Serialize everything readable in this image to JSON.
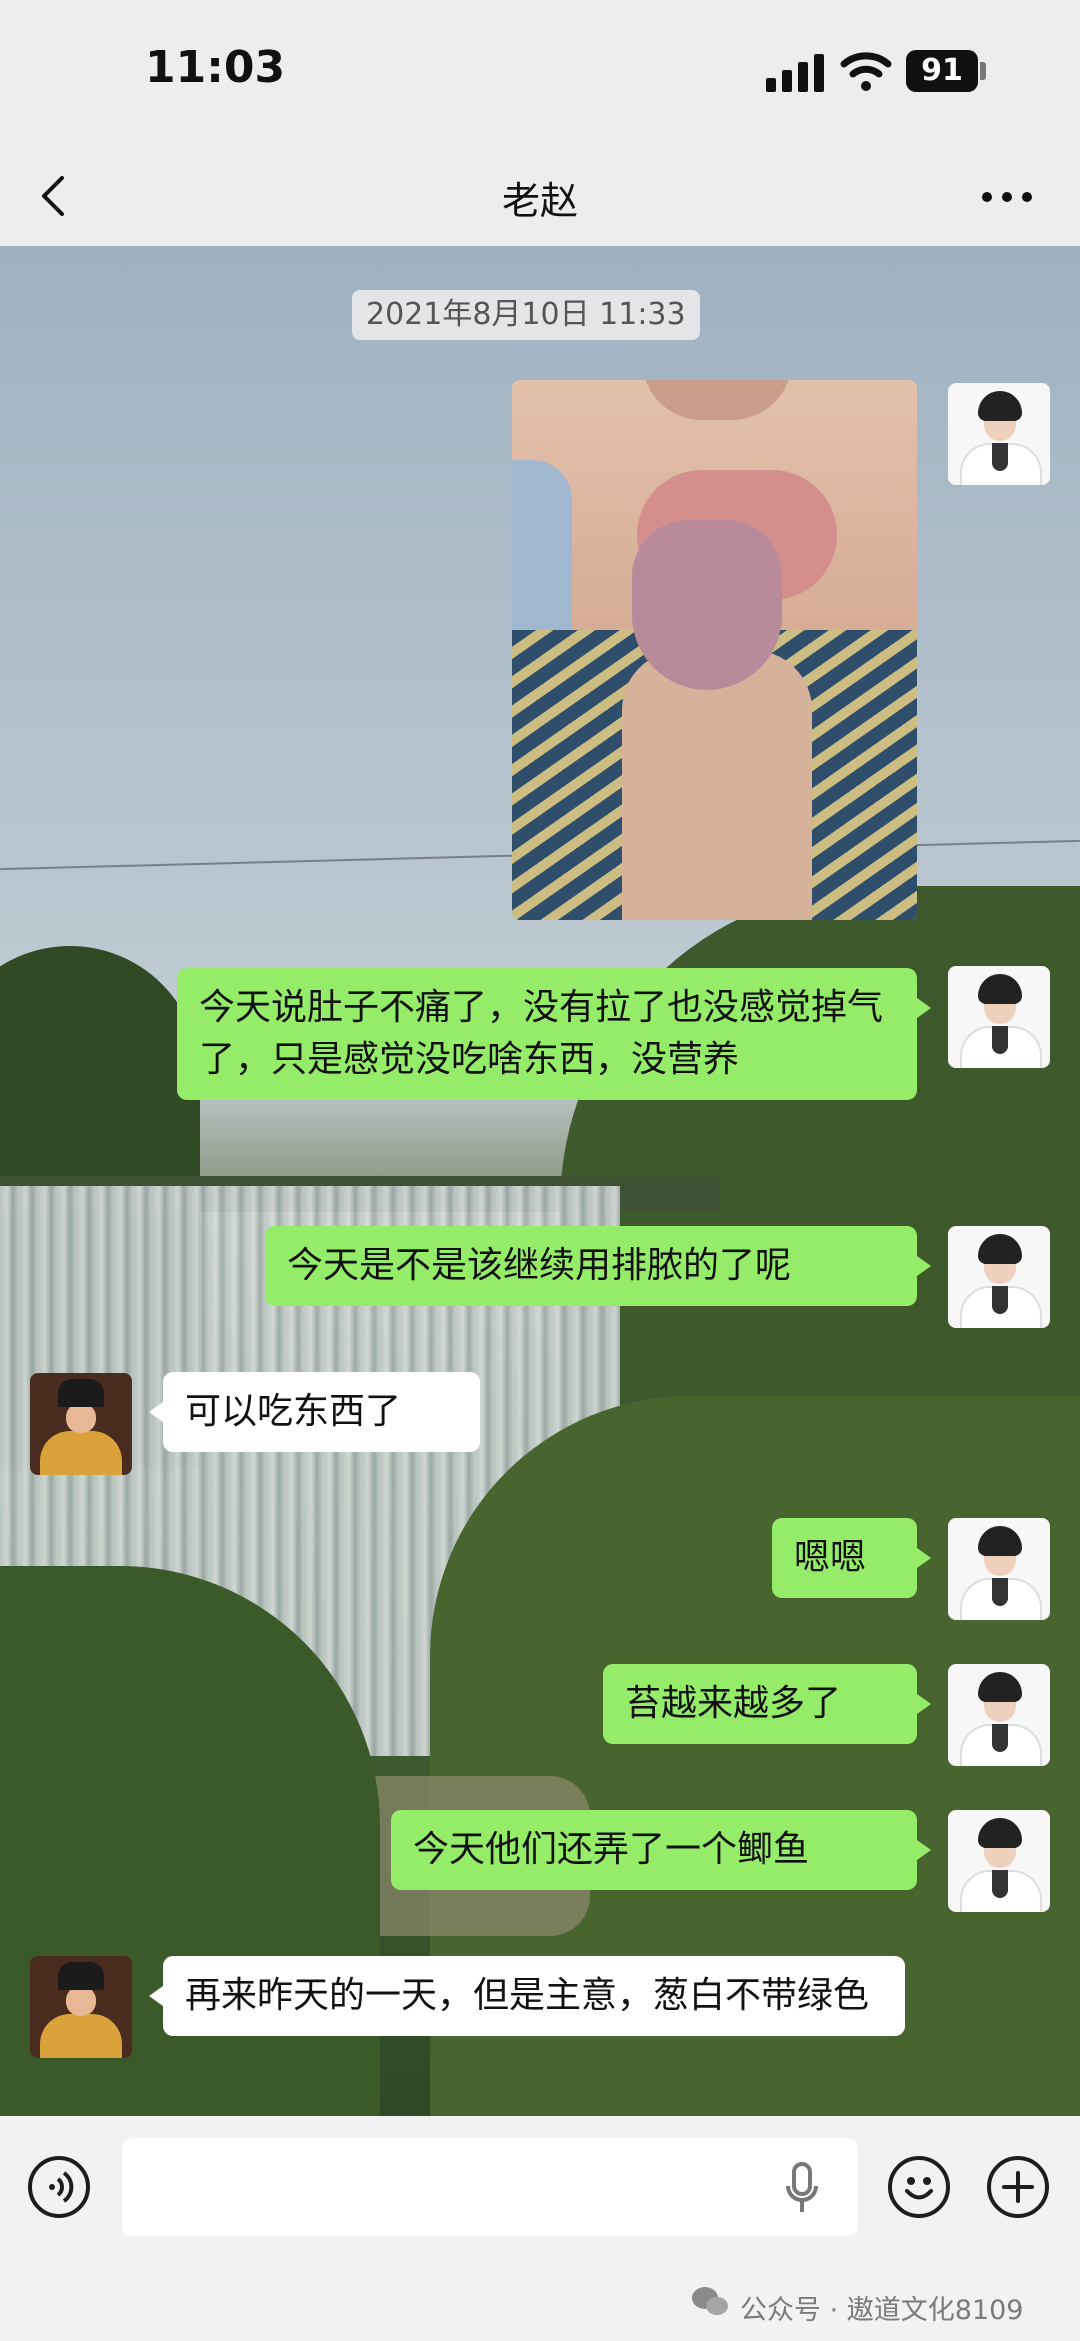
{
  "status_bar": {
    "time": "11:03",
    "battery": "91"
  },
  "nav": {
    "title": "老赵"
  },
  "chat": {
    "timestamp": "2021年8月10日 11:33",
    "messages": [
      {
        "side": "out",
        "type": "image"
      },
      {
        "side": "out",
        "text": "今天说肚子不痛了，没有拉了也没感觉掉气了，只是感觉没吃啥东西，没营养"
      },
      {
        "side": "out",
        "text": "今天是不是该继续用排脓的了呢"
      },
      {
        "side": "in",
        "text": "可以吃东西了"
      },
      {
        "side": "out",
        "text": "嗯嗯"
      },
      {
        "side": "out",
        "text": "苔越来越多了"
      },
      {
        "side": "out",
        "text": "今天他们还弄了一个鲫鱼"
      },
      {
        "side": "in",
        "text": "再来昨天的一天，但是主意，葱白不带绿色"
      }
    ]
  },
  "input_bar": {
    "text": ""
  },
  "watermark": {
    "text": "公众号 · 遨道文化8109"
  },
  "colors": {
    "bubble_out": "#95ec69",
    "bubble_in": "#ffffff",
    "background": "#ededed"
  },
  "icons": [
    "back-icon",
    "more-icon",
    "signal-icon",
    "wifi-icon",
    "voice-icon",
    "mic-icon",
    "emoji-icon",
    "plus-icon",
    "wechat-icon"
  ]
}
